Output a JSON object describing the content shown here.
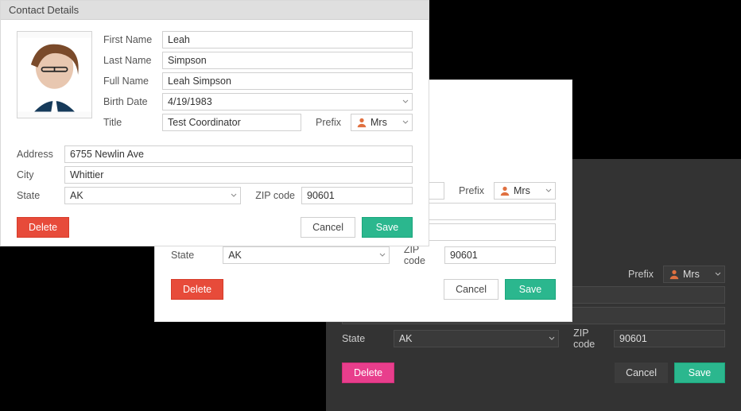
{
  "window": {
    "title": "Contact Details"
  },
  "labels": {
    "first_name": "First Name",
    "last_name": "Last Name",
    "full_name": "Full Name",
    "birth_date": "Birth Date",
    "title": "Title",
    "prefix": "Prefix",
    "address": "Address",
    "city": "City",
    "state": "State",
    "zip": "ZIP code"
  },
  "contact": {
    "first_name": "Leah",
    "last_name": "Simpson",
    "full_name": "Leah Simpson",
    "birth_date": "4/19/1983",
    "title": "Test Coordinator",
    "prefix": "Mrs",
    "address": "6755 Newlin Ave",
    "city": "Whittier",
    "state": "AK",
    "zip": "90601"
  },
  "buttons": {
    "delete": "Delete",
    "cancel": "Cancel",
    "save": "Save"
  }
}
